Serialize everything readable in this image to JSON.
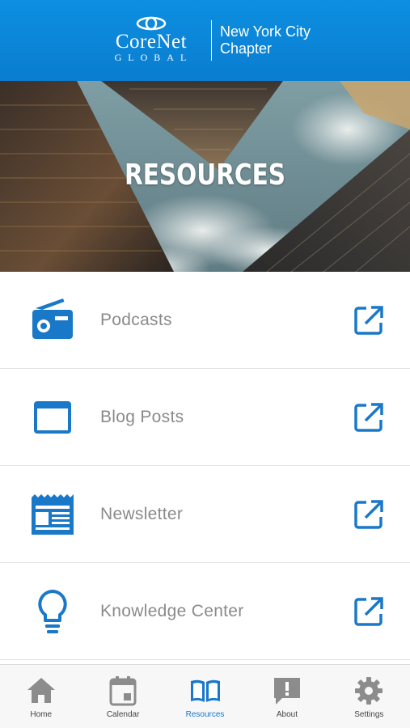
{
  "header": {
    "logo_word": "CoreNet",
    "logo_sub": "GLOBAL",
    "chapter_line1": "New York City",
    "chapter_line2": "Chapter"
  },
  "hero": {
    "title": "RESOURCES"
  },
  "resources": [
    {
      "label": "Podcasts",
      "icon": "radio-icon"
    },
    {
      "label": "Blog Posts",
      "icon": "browser-window-icon"
    },
    {
      "label": "Newsletter",
      "icon": "newspaper-icon"
    },
    {
      "label": "Knowledge Center",
      "icon": "lightbulb-icon"
    }
  ],
  "tabs": [
    {
      "label": "Home",
      "icon": "home-icon",
      "active": false
    },
    {
      "label": "Calendar",
      "icon": "calendar-icon",
      "active": false
    },
    {
      "label": "Resources",
      "icon": "book-icon",
      "active": true
    },
    {
      "label": "About",
      "icon": "alert-speech-icon",
      "active": false
    },
    {
      "label": "Settings",
      "icon": "gear-icon",
      "active": false
    }
  ],
  "colors": {
    "brand_blue": "#0a7dd0",
    "icon_blue": "#1a78c8",
    "tab_inactive": "#8c8c8c",
    "label_gray": "#8a8a8a"
  }
}
